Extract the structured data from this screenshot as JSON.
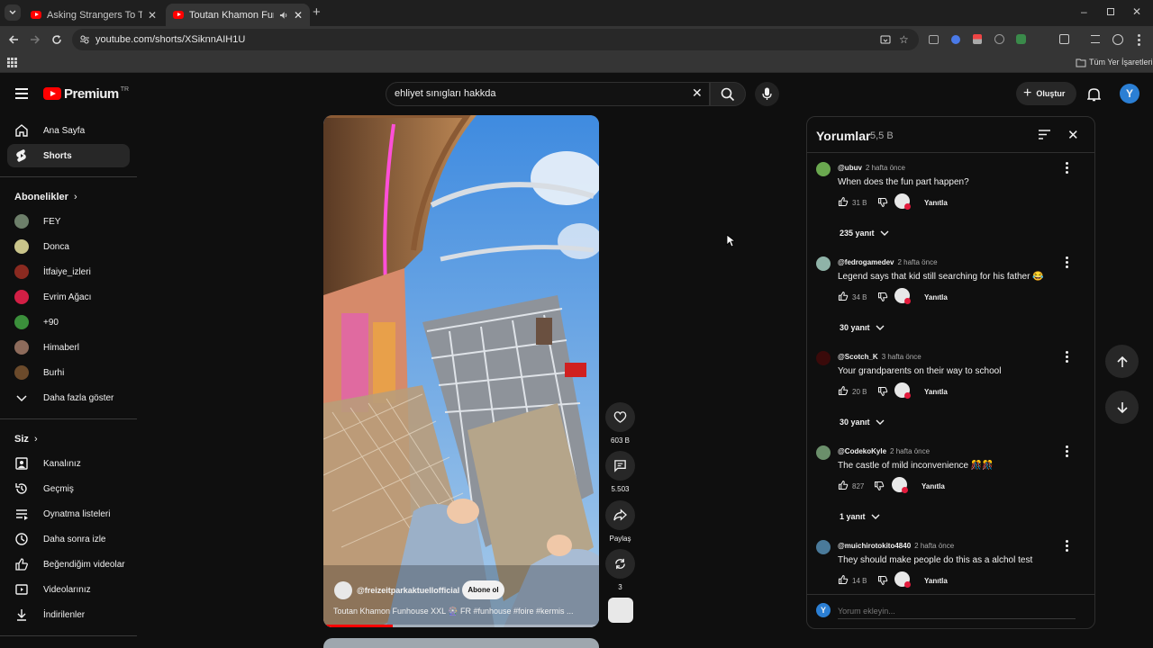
{
  "browser": {
    "tabs": [
      {
        "title": "Asking Strangers To Transform",
        "active": false
      },
      {
        "title": "Toutan Khamon Funhouse",
        "active": true
      }
    ],
    "url": "youtube.com/shorts/XSiknnAIH1U",
    "bookmarks_label": "Tüm Yer İşaretleri"
  },
  "masthead": {
    "logo": "Premium",
    "region": "TR",
    "search_value": "ehliyet sınıgları hakkda",
    "create_label": "Oluştur",
    "account_initial": "Y",
    "brand_color": "#ff0000"
  },
  "sidebar": {
    "home": "Ana Sayfa",
    "shorts": "Shorts",
    "subs_heading": "Abonelikler",
    "subscriptions": [
      {
        "name": "FEY",
        "color": "#6d7f6a"
      },
      {
        "name": "Donca",
        "color": "#c9c48a"
      },
      {
        "name": "İtfaiye_izleri",
        "color": "#8a2a20"
      },
      {
        "name": "Evrim Ağacı",
        "color": "#d21f45"
      },
      {
        "name": "+90",
        "color": "#3b8f3b"
      },
      {
        "name": "Himaberl",
        "color": "#8d6b5b"
      },
      {
        "name": "Burhi",
        "color": "#6b4a2b"
      }
    ],
    "show_more": "Daha fazla göster",
    "you_heading": "Siz",
    "you_items": [
      "Kanalınız",
      "Geçmiş",
      "Oynatma listeleri",
      "Daha sonra izle",
      "Beğendiğim videolar",
      "Videolarınız",
      "İndirilenler"
    ]
  },
  "short": {
    "channel": "@freizeitparkaktuellofficial",
    "subscribe_label": "Abone ol",
    "title": "Toutan Khamon Funhouse XXL 🎡 FR #funhouse #foire #kermis ...",
    "progress": 0.25,
    "actions": {
      "likes": "603 B",
      "comments": "5.503",
      "share": "Paylaş",
      "remix": "3"
    }
  },
  "comments": {
    "title": "Yorumlar",
    "count": "5,5 B",
    "reply_label": "Yanıtla",
    "add_placeholder": "Yorum ekleyin...",
    "items": [
      {
        "author": "@ubuv",
        "time": "2 hafta önce",
        "text": "When does the fun part happen?",
        "likes": "31 B",
        "replies": "235 yanıt",
        "avatar_color": "#6aa84f"
      },
      {
        "author": "@fedrogamedev",
        "time": "2 hafta önce",
        "text": "Legend says that kid still searching for his father 😂",
        "likes": "34 B",
        "replies": "30 yanıt",
        "avatar_color": "#8fb3a8"
      },
      {
        "author": "@Scotch_K",
        "time": "3 hafta önce",
        "text": "Your grandparents on their way to school",
        "likes": "20 B",
        "replies": "30 yanıt",
        "avatar_color": "#3a0a0a"
      },
      {
        "author": "@CodekoKyle",
        "time": "2 hafta önce",
        "text": "The castle of mild inconvenience 🎊🎊",
        "likes": "827",
        "replies": "1 yanıt",
        "avatar_color": "#6b8f6b"
      },
      {
        "author": "@muichirotokito4840",
        "time": "2 hafta önce",
        "text": "They should make people do this as a alchol test",
        "likes": "14 B",
        "replies": "",
        "avatar_color": "#4a7a9a"
      }
    ]
  }
}
